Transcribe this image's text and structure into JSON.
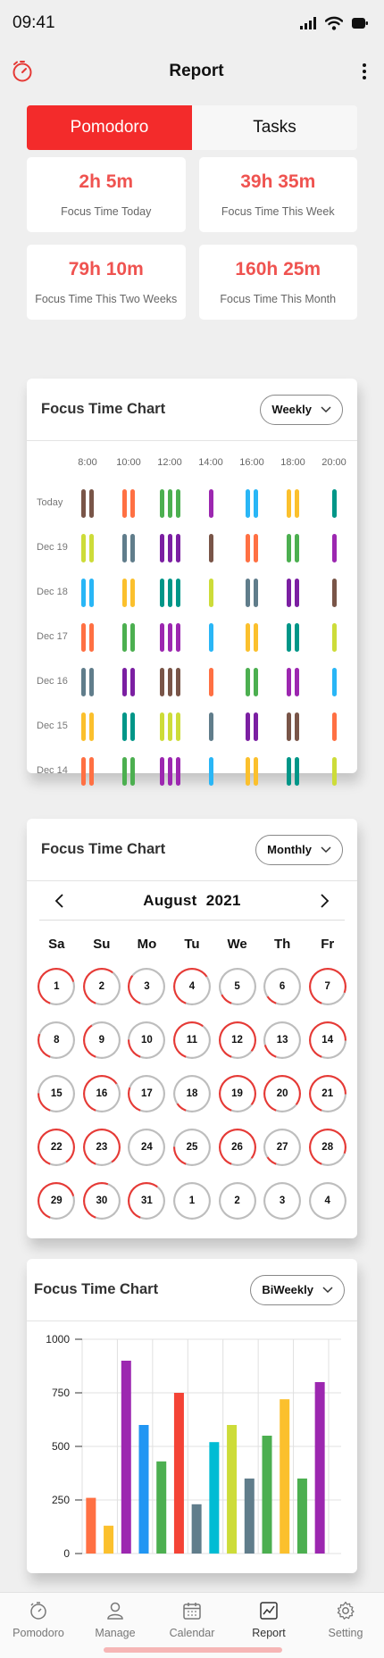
{
  "status_bar": {
    "time": "09:41",
    "signal_icon": "signal-icon",
    "wifi_icon": "wifi-icon",
    "battery_icon": "battery-icon"
  },
  "app_bar": {
    "title": "Report",
    "left_icon": "timer-icon",
    "right_icon": "more-vertical-icon"
  },
  "tabs": [
    {
      "label": "Pomodoro",
      "active": true
    },
    {
      "label": "Tasks",
      "active": false
    }
  ],
  "stats": [
    {
      "value": "2h 5m",
      "label": "Focus Time Today"
    },
    {
      "value": "39h 35m",
      "label": "Focus Time This  Week"
    },
    {
      "value": "79h 10m",
      "label": "Focus Time This Two Weeks"
    },
    {
      "value": "160h 25m",
      "label": "Focus Time This Month"
    }
  ],
  "weekly_chart": {
    "title": "Focus Time Chart",
    "dropdown": "Weekly",
    "hours": [
      "8:00",
      "10:00",
      "12:00",
      "14:00",
      "16:00",
      "18:00",
      "20:00"
    ],
    "rows": [
      {
        "label": "Today",
        "bars": [
          [
            2,
            "#795548"
          ],
          [
            2,
            "#ff7043"
          ],
          [
            3,
            "#4caf50"
          ],
          [
            1,
            "#9c27b0"
          ],
          [
            2,
            "#29b6f6"
          ],
          [
            2,
            "#fbc02d"
          ],
          [
            1,
            "#009688"
          ]
        ]
      },
      {
        "label": "Dec 19",
        "bars": [
          [
            2,
            "#cddc39"
          ],
          [
            2,
            "#607d8b"
          ],
          [
            3,
            "#7b1fa2"
          ],
          [
            1,
            "#795548"
          ],
          [
            2,
            "#ff7043"
          ],
          [
            2,
            "#4caf50"
          ],
          [
            1,
            "#9c27b0"
          ]
        ]
      },
      {
        "label": "Dec 18",
        "bars": [
          [
            2,
            "#29b6f6"
          ],
          [
            2,
            "#fbc02d"
          ],
          [
            3,
            "#009688"
          ],
          [
            1,
            "#cddc39"
          ],
          [
            2,
            "#607d8b"
          ],
          [
            2,
            "#7b1fa2"
          ],
          [
            1,
            "#795548"
          ]
        ]
      },
      {
        "label": "Dec 17",
        "bars": [
          [
            2,
            "#ff7043"
          ],
          [
            2,
            "#4caf50"
          ],
          [
            3,
            "#9c27b0"
          ],
          [
            1,
            "#29b6f6"
          ],
          [
            2,
            "#fbc02d"
          ],
          [
            2,
            "#009688"
          ],
          [
            1,
            "#cddc39"
          ]
        ]
      },
      {
        "label": "Dec 16",
        "bars": [
          [
            2,
            "#607d8b"
          ],
          [
            2,
            "#7b1fa2"
          ],
          [
            3,
            "#795548"
          ],
          [
            1,
            "#ff7043"
          ],
          [
            2,
            "#4caf50"
          ],
          [
            2,
            "#9c27b0"
          ],
          [
            1,
            "#29b6f6"
          ]
        ]
      },
      {
        "label": "Dec 15",
        "bars": [
          [
            2,
            "#fbc02d"
          ],
          [
            2,
            "#009688"
          ],
          [
            3,
            "#cddc39"
          ],
          [
            1,
            "#607d8b"
          ],
          [
            2,
            "#7b1fa2"
          ],
          [
            2,
            "#795548"
          ],
          [
            1,
            "#ff7043"
          ]
        ]
      },
      {
        "label": "Dec 14",
        "bars": [
          [
            2,
            "#ff7043"
          ],
          [
            2,
            "#4caf50"
          ],
          [
            3,
            "#9c27b0"
          ],
          [
            1,
            "#29b6f6"
          ],
          [
            2,
            "#fbc02d"
          ],
          [
            2,
            "#009688"
          ],
          [
            1,
            "#cddc39"
          ]
        ]
      }
    ]
  },
  "monthly_chart": {
    "title": "Focus Time Chart",
    "dropdown": "Monthly",
    "month": "August",
    "year": "2021",
    "weekdays": [
      "Sa",
      "Su",
      "Mo",
      "Tu",
      "We",
      "Th",
      "Fr"
    ],
    "days": [
      {
        "d": "1",
        "p": 0.65
      },
      {
        "d": "2",
        "p": 0.55
      },
      {
        "d": "3",
        "p": 0.3
      },
      {
        "d": "4",
        "p": 0.6
      },
      {
        "d": "5",
        "p": 0.12
      },
      {
        "d": "6",
        "p": 0.1
      },
      {
        "d": "7",
        "p": 0.75
      },
      {
        "d": "8",
        "p": 0.25
      },
      {
        "d": "9",
        "p": 0.35
      },
      {
        "d": "10",
        "p": 0.2
      },
      {
        "d": "11",
        "p": 0.55
      },
      {
        "d": "12",
        "p": 0.8
      },
      {
        "d": "13",
        "p": 0.15
      },
      {
        "d": "14",
        "p": 0.7
      },
      {
        "d": "15",
        "p": 0.2
      },
      {
        "d": "16",
        "p": 0.6
      },
      {
        "d": "17",
        "p": 0.25
      },
      {
        "d": "18",
        "p": 0.1
      },
      {
        "d": "19",
        "p": 0.8
      },
      {
        "d": "20",
        "p": 0.8
      },
      {
        "d": "21",
        "p": 0.7
      },
      {
        "d": "22",
        "p": 0.85
      },
      {
        "d": "23",
        "p": 0.85
      },
      {
        "d": "24",
        "p": 0
      },
      {
        "d": "25",
        "p": 0.2
      },
      {
        "d": "26",
        "p": 0.8
      },
      {
        "d": "27",
        "p": 0.1
      },
      {
        "d": "28",
        "p": 0.75
      },
      {
        "d": "29",
        "p": 0.65
      },
      {
        "d": "30",
        "p": 0.5
      },
      {
        "d": "31",
        "p": 0.55
      },
      {
        "d": "1",
        "p": 0
      },
      {
        "d": "2",
        "p": 0
      },
      {
        "d": "3",
        "p": 0
      },
      {
        "d": "4",
        "p": 0
      }
    ]
  },
  "chart_data": {
    "type": "bar",
    "title": "Focus Time Chart",
    "dropdown": "BiWeekly",
    "ylim": [
      0,
      1000
    ],
    "yticks": [
      "0",
      "250",
      "500",
      "750",
      "1000"
    ],
    "values": [
      260,
      130,
      900,
      600,
      430,
      750,
      230,
      520,
      600,
      350,
      550,
      720,
      350,
      800
    ],
    "colors": [
      "#ff7043",
      "#fbc02d",
      "#9c27b0",
      "#2196f3",
      "#4caf50",
      "#f44336",
      "#607d8b",
      "#00bcd4",
      "#cddc39",
      "#607d8b",
      "#4caf50",
      "#fbc02d",
      "#4caf50",
      "#9c27b0"
    ]
  },
  "bottom_nav": [
    {
      "label": "Pomodoro",
      "icon": "stopwatch-icon",
      "active": false
    },
    {
      "label": "Manage",
      "icon": "user-icon",
      "active": false
    },
    {
      "label": "Calendar",
      "icon": "calendar-icon",
      "active": false
    },
    {
      "label": "Report",
      "icon": "report-icon",
      "active": true
    },
    {
      "label": "Setting",
      "icon": "gear-icon",
      "active": false
    }
  ]
}
